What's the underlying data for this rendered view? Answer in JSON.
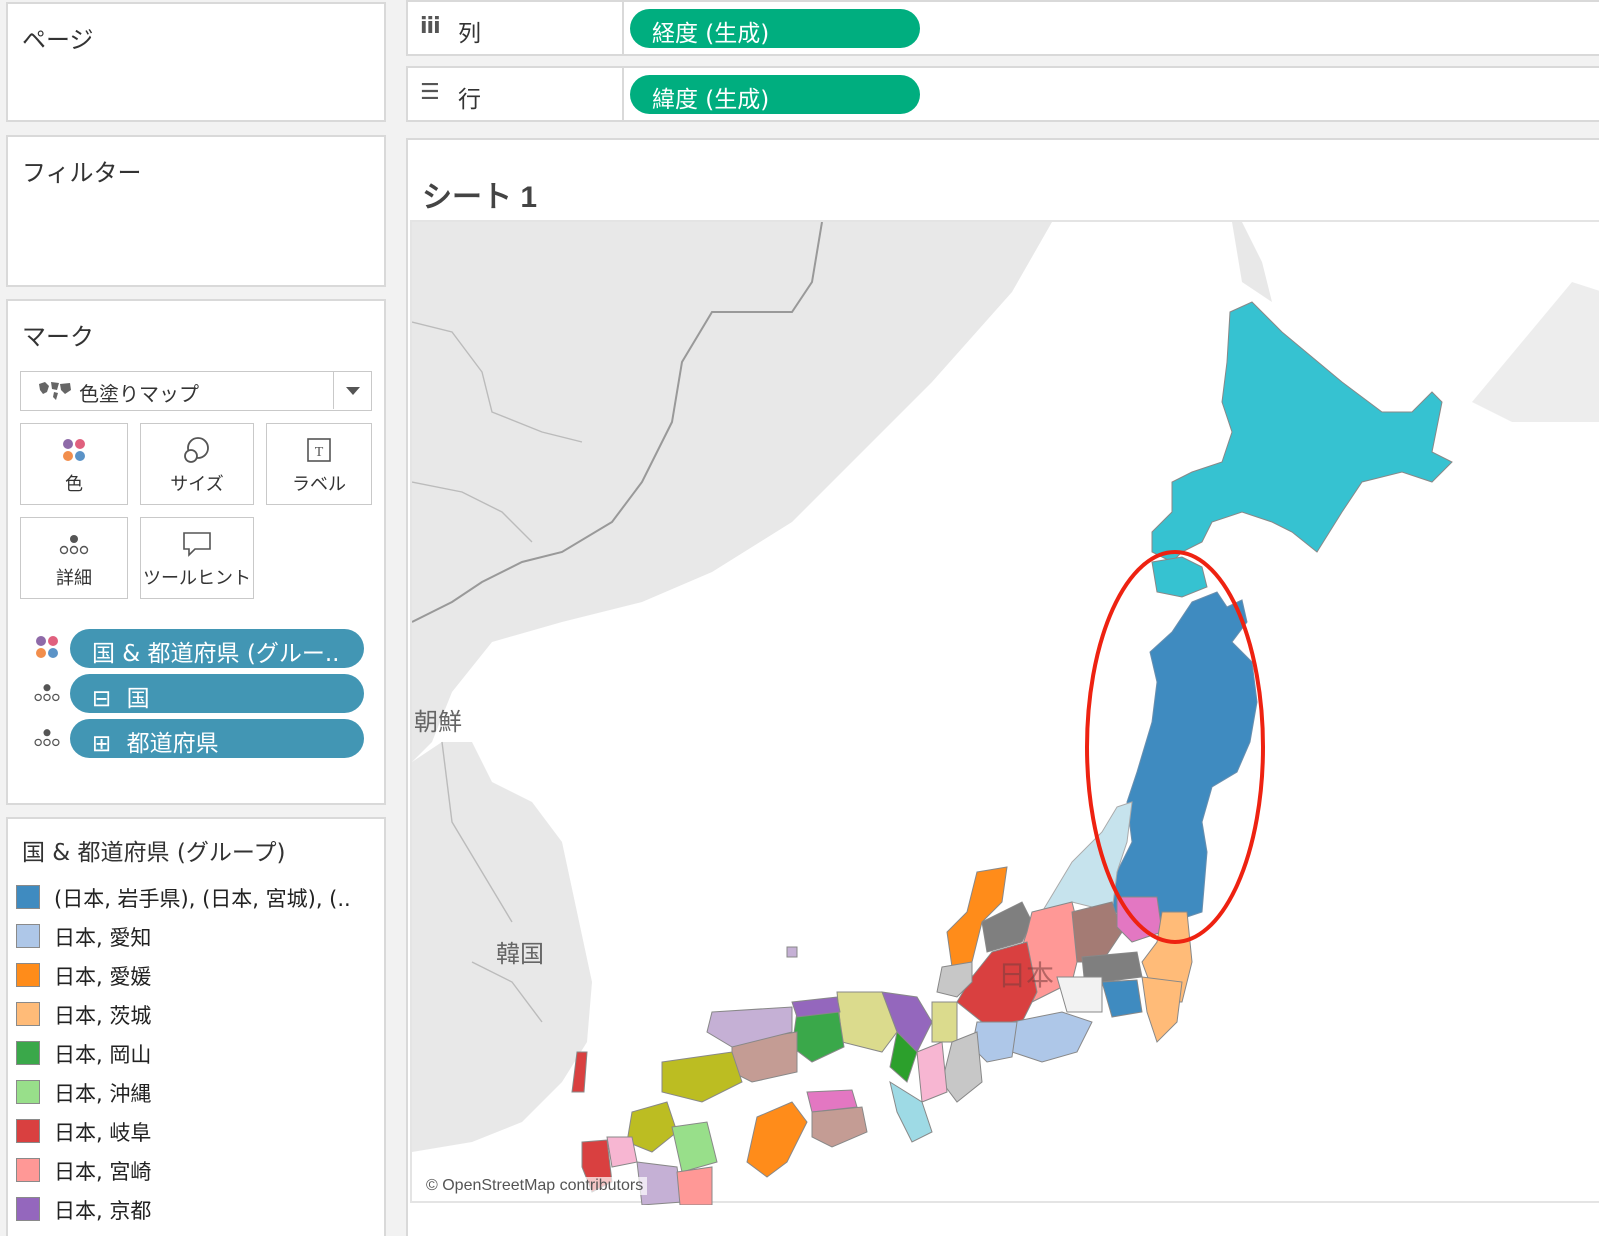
{
  "pages": {
    "title": "ページ"
  },
  "columns_shelf": {
    "label": "列",
    "pill": "経度 (生成)"
  },
  "rows_shelf": {
    "label": "行",
    "pill": "緯度 (生成)"
  },
  "filters": {
    "title": "フィルター"
  },
  "marks": {
    "title": "マーク",
    "mark_type": "色塗りマップ",
    "buttons": {
      "color": "色",
      "size": "サイズ",
      "label": "ラベル",
      "detail": "詳細",
      "tooltip": "ツールヒント"
    },
    "fields": [
      {
        "label": "国 & 都道府県 (グルー..",
        "icon": "color-dots-icon"
      },
      {
        "label": "国",
        "icon": "detail-dots-icon",
        "toggle": "⊟"
      },
      {
        "label": "都道府県",
        "icon": "detail-dots-icon",
        "toggle": "⊞"
      }
    ]
  },
  "legend": {
    "title": "国 & 都道府県 (グループ)",
    "items": [
      {
        "label": "(日本, 岩手県), (日本, 宮城), (..",
        "color": "#3f8bc0"
      },
      {
        "label": "日本, 愛知",
        "color": "#aec7e8"
      },
      {
        "label": "日本, 愛媛",
        "color": "#ff8c1a"
      },
      {
        "label": "日本, 茨城",
        "color": "#ffbb78"
      },
      {
        "label": "日本, 岡山",
        "color": "#3aa84a"
      },
      {
        "label": "日本, 沖縄",
        "color": "#98df8a"
      },
      {
        "label": "日本, 岐阜",
        "color": "#d94040"
      },
      {
        "label": "日本, 宮崎",
        "color": "#ff9896"
      },
      {
        "label": "日本, 京都",
        "color": "#9467bd"
      }
    ]
  },
  "sheet": {
    "title": "シート 1"
  },
  "map": {
    "labels": {
      "korea_north": "朝鮮",
      "korea_south": "韓国",
      "japan": "日本"
    },
    "attribution": "© OpenStreetMap contributors",
    "colors": {
      "hokkaido": "#36c2d1",
      "tohoku_group": "#3f8bc0",
      "highlight_circle": "#ee2211",
      "land_background": "#e6e6e6",
      "sea": "#ffffff"
    }
  }
}
